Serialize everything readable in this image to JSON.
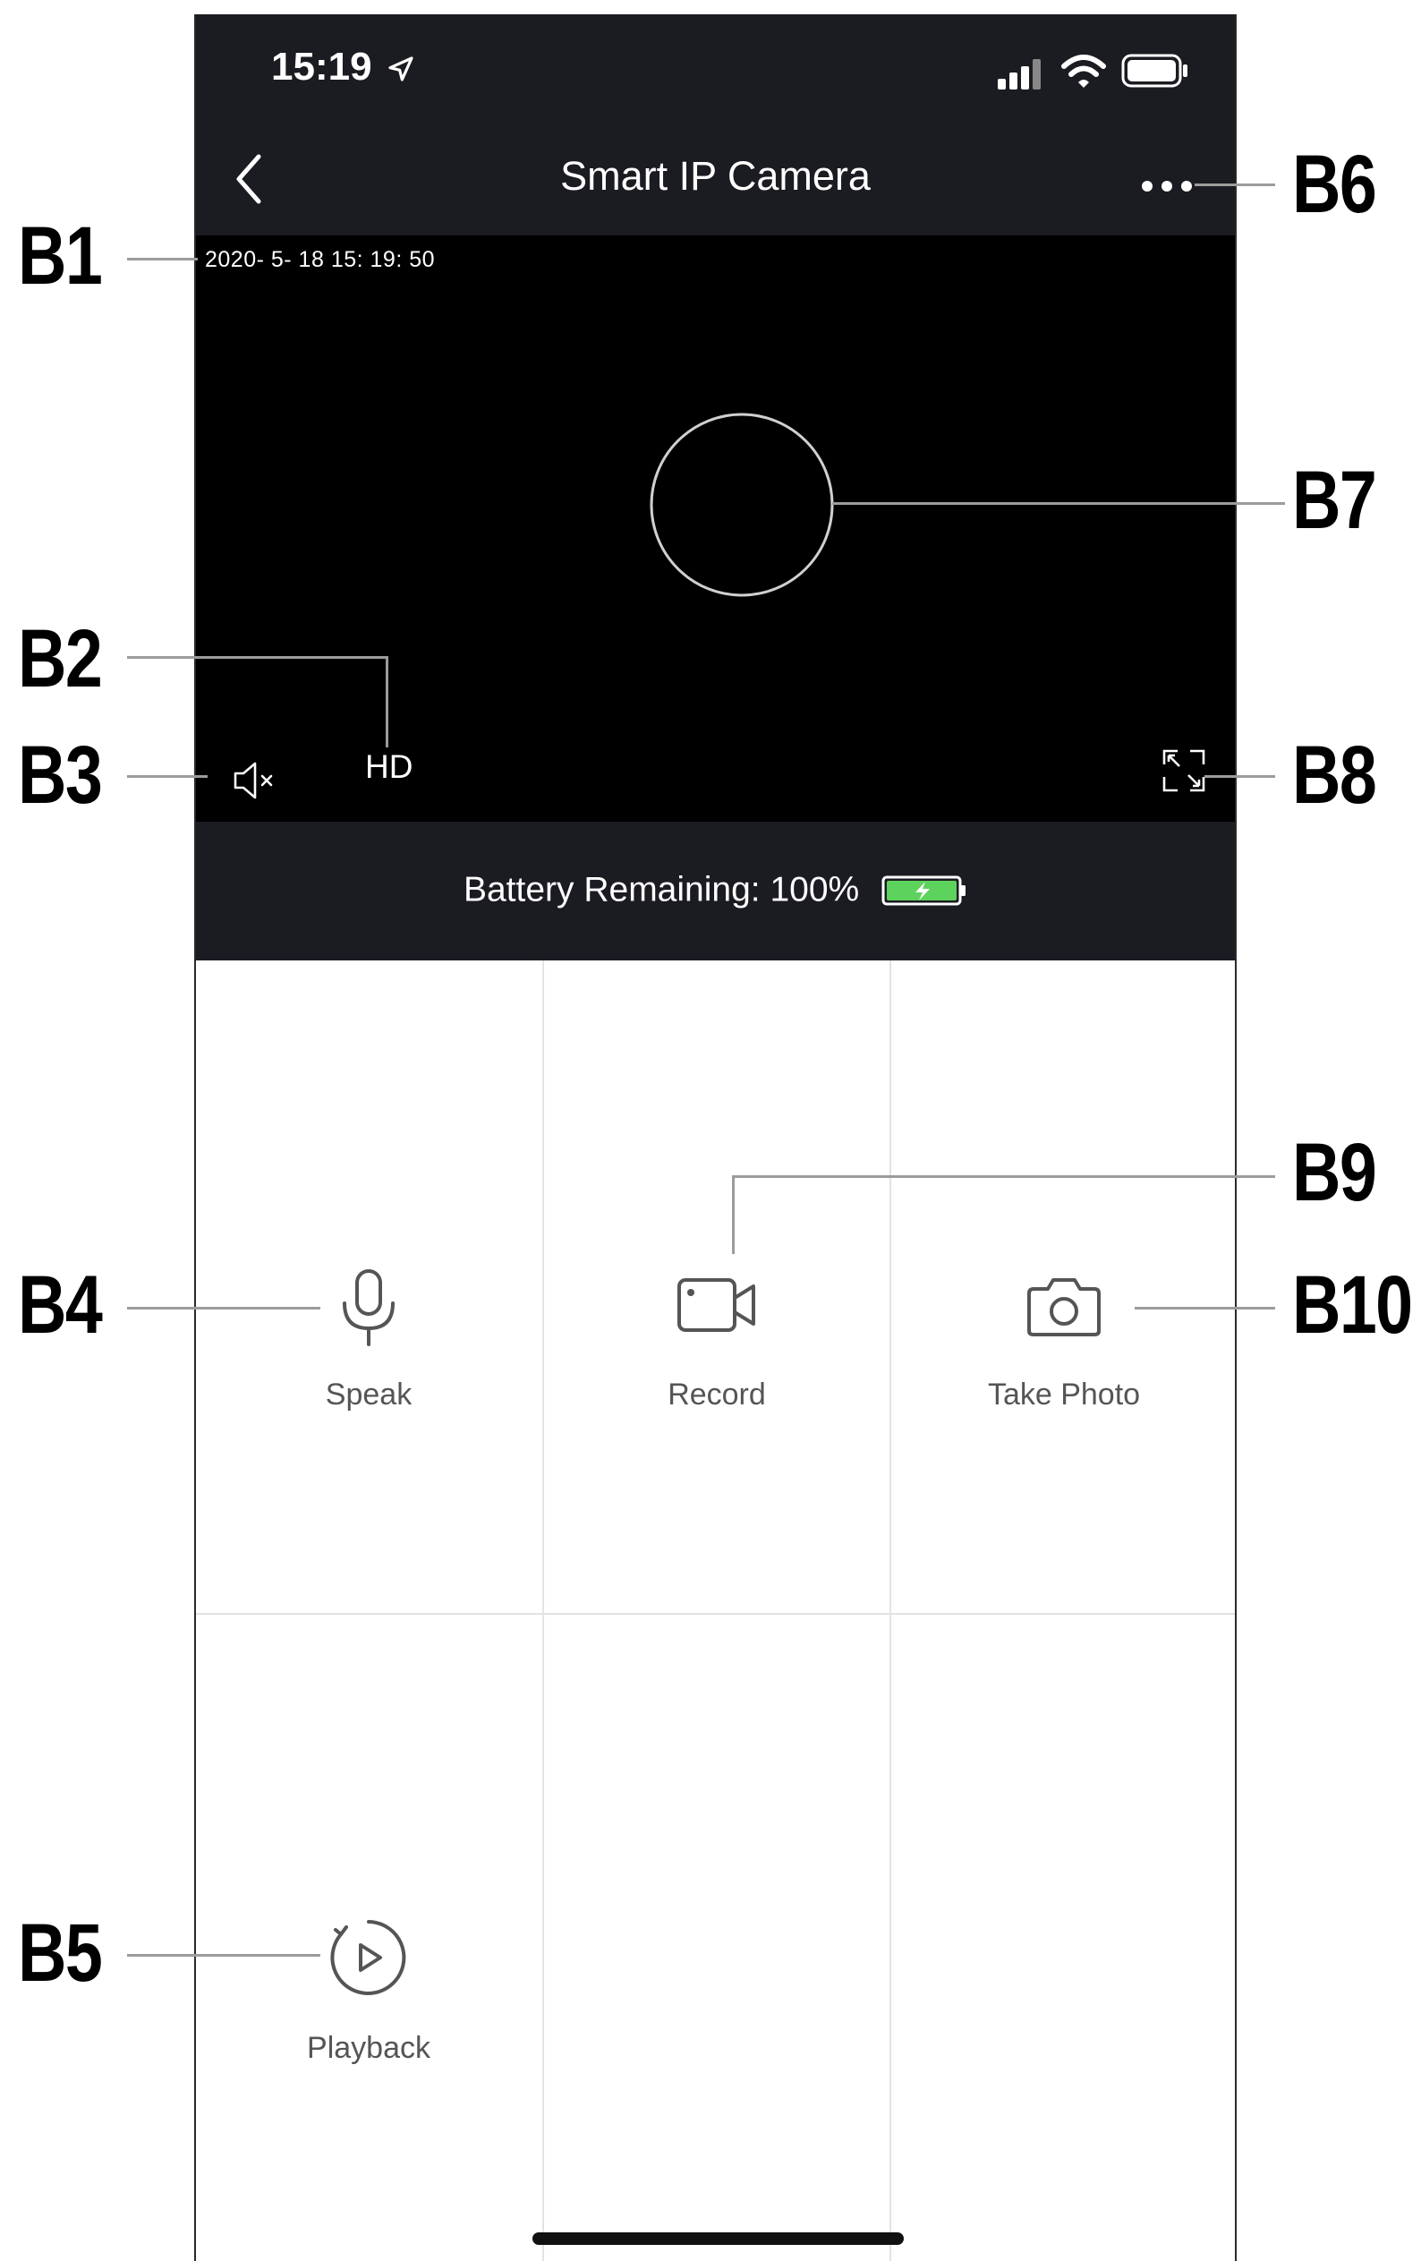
{
  "status_bar": {
    "time": "15:19"
  },
  "header": {
    "title": "Smart IP Camera"
  },
  "video": {
    "timestamp": "2020- 5- 18  15: 19: 50",
    "quality_label": "HD"
  },
  "battery": {
    "text": "Battery Remaining: 100%",
    "level": 1.0,
    "color": "#5dd35d"
  },
  "actions": [
    {
      "label": "Speak",
      "icon": "microphone-icon"
    },
    {
      "label": "Record",
      "icon": "video-camera-icon"
    },
    {
      "label": "Take Photo",
      "icon": "camera-icon"
    },
    {
      "label": "Playback",
      "icon": "playback-icon"
    }
  ],
  "callouts": [
    "B1",
    "B2",
    "B3",
    "B4",
    "B5",
    "B6",
    "B7",
    "B8",
    "B9",
    "B10"
  ],
  "colors": {
    "header_bg": "#1b1b22",
    "video_bg": "#000000",
    "label": "#555555"
  }
}
